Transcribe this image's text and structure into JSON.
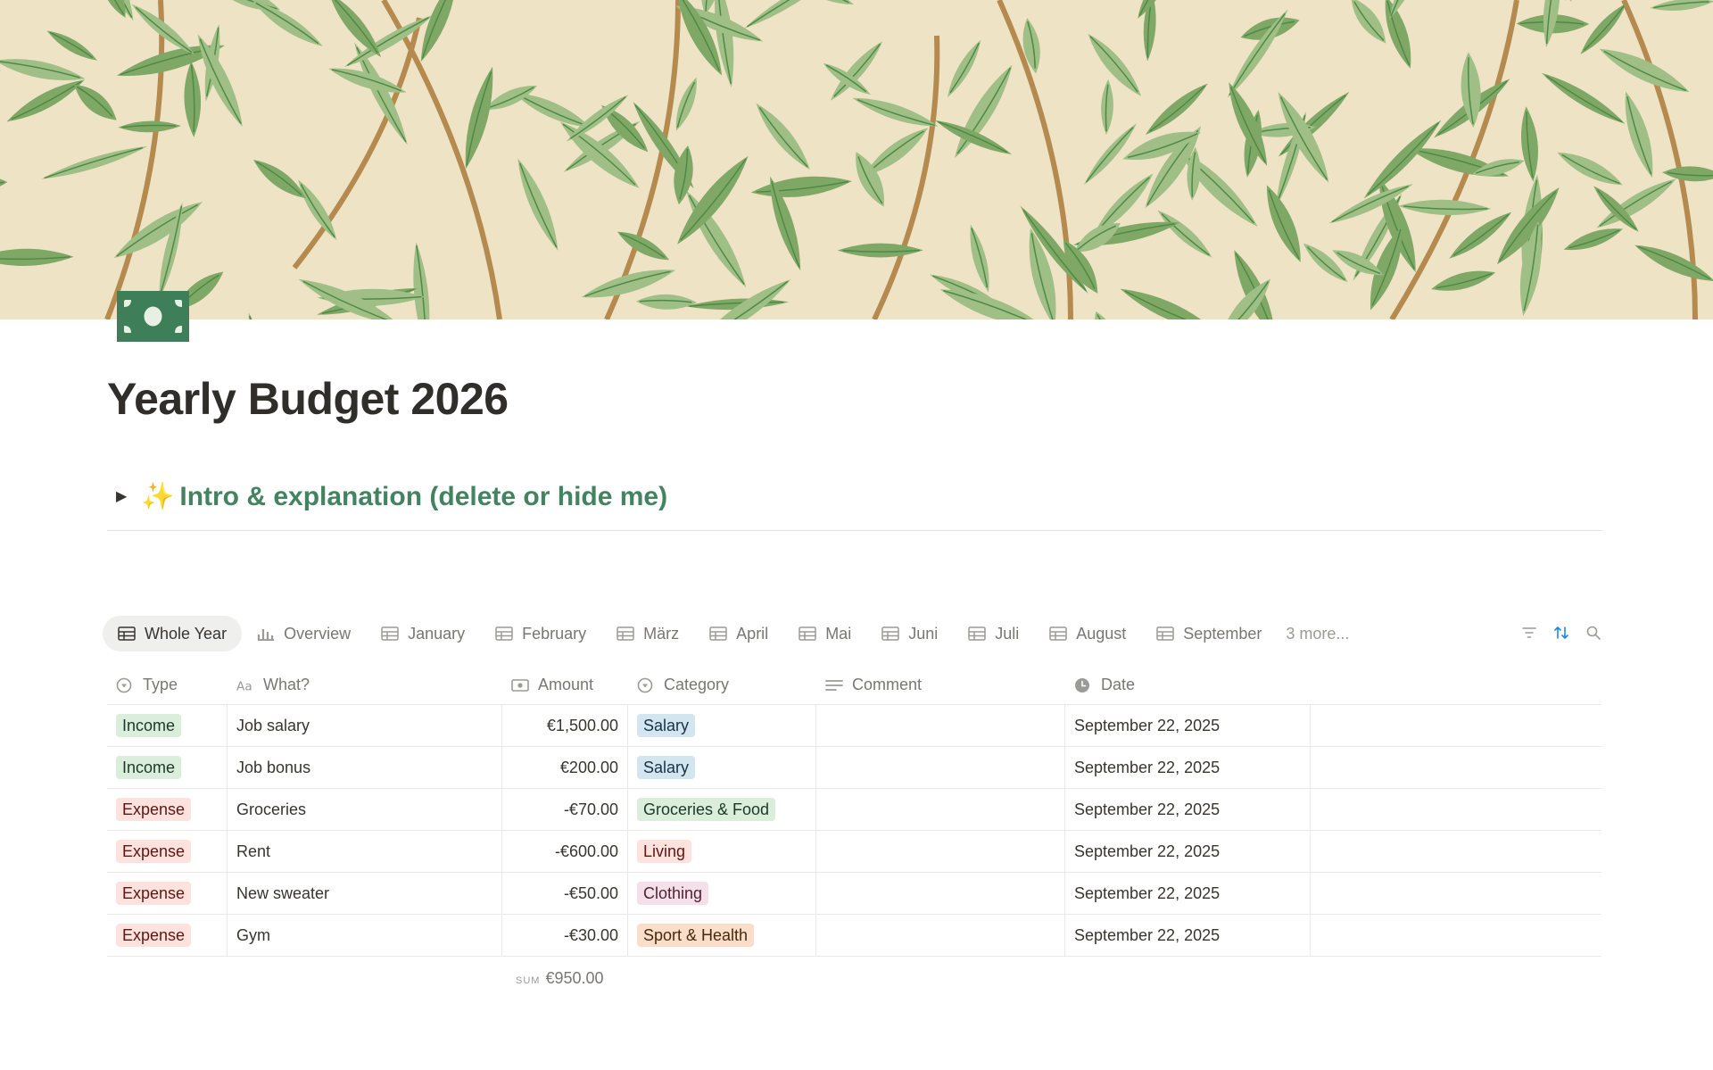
{
  "page": {
    "title": "Yearly Budget 2026",
    "icon": "money-bill-icon",
    "cover": "willow-leaf-pattern"
  },
  "toggle": {
    "sparkle": "✨",
    "text": "Intro & explanation (delete or hide me)",
    "arrow": "▶"
  },
  "tabs": [
    {
      "label": "Whole Year",
      "icon": "table-icon",
      "active": true
    },
    {
      "label": "Overview",
      "icon": "bar-chart-icon"
    },
    {
      "label": "January",
      "icon": "table-icon"
    },
    {
      "label": "February",
      "icon": "table-icon"
    },
    {
      "label": "März",
      "icon": "table-icon"
    },
    {
      "label": "April",
      "icon": "table-icon"
    },
    {
      "label": "Mai",
      "icon": "table-icon"
    },
    {
      "label": "Juni",
      "icon": "table-icon"
    },
    {
      "label": "Juli",
      "icon": "table-icon"
    },
    {
      "label": "August",
      "icon": "table-icon"
    },
    {
      "label": "September",
      "icon": "table-icon"
    }
  ],
  "tabs_more": "3 more...",
  "tools": [
    "filter-icon",
    "sort-icon",
    "search-icon"
  ],
  "columns": {
    "type": "Type",
    "what": "What?",
    "amount": "Amount",
    "category": "Category",
    "comment": "Comment",
    "date": "Date"
  },
  "rows": [
    {
      "type": "Income",
      "what": "Job salary",
      "amount": "€1,500.00",
      "category": "Salary",
      "comment": "",
      "date": "September 22, 2025"
    },
    {
      "type": "Income",
      "what": "Job bonus",
      "amount": "€200.00",
      "category": "Salary",
      "comment": "",
      "date": "September 22, 2025"
    },
    {
      "type": "Expense",
      "what": "Groceries",
      "amount": "-€70.00",
      "category": "Groceries & Food",
      "comment": "",
      "date": "September 22, 2025"
    },
    {
      "type": "Expense",
      "what": "Rent",
      "amount": "-€600.00",
      "category": "Living",
      "comment": "",
      "date": "September 22, 2025"
    },
    {
      "type": "Expense",
      "what": "New sweater",
      "amount": "-€50.00",
      "category": "Clothing",
      "comment": "",
      "date": "September 22, 2025"
    },
    {
      "type": "Expense",
      "what": "Gym",
      "amount": "-€30.00",
      "category": "Sport & Health",
      "comment": "",
      "date": "September 22, 2025"
    }
  ],
  "sum": {
    "label": "SUM",
    "value": "€950.00"
  },
  "colors": {
    "Income": {
      "bg": "#dbeddb",
      "fg": "#1c3829"
    },
    "Expense": {
      "bg": "#ffe2dd",
      "fg": "#5d1715"
    },
    "Salary": {
      "bg": "#d3e5ef",
      "fg": "#183347"
    },
    "Groceries & Food": {
      "bg": "#dbeddb",
      "fg": "#1c3829"
    },
    "Living": {
      "bg": "#ffe2dd",
      "fg": "#5d1715"
    },
    "Clothing": {
      "bg": "#f5e0e9",
      "fg": "#4c2337"
    },
    "Sport & Health": {
      "bg": "#fadec9",
      "fg": "#49290e"
    },
    "accent": "#448361",
    "sort_active": "#2383e2"
  }
}
